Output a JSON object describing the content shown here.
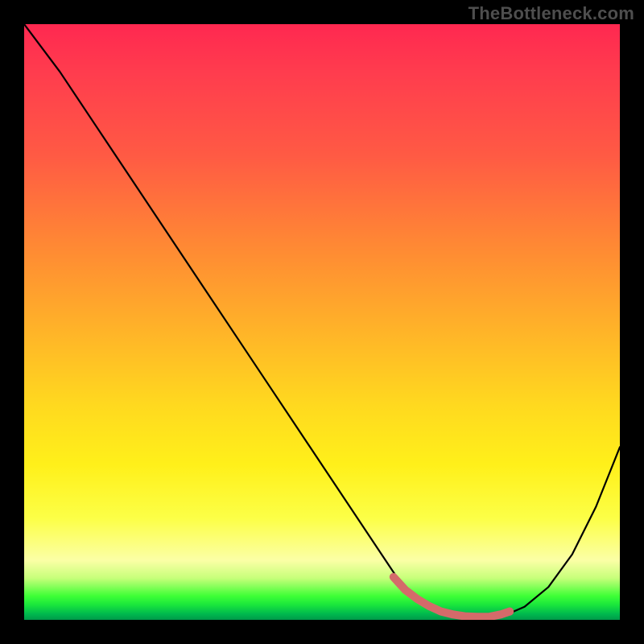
{
  "watermark": "TheBottleneck.com",
  "chart_data": {
    "type": "line",
    "title": "",
    "xlabel": "",
    "ylabel": "",
    "xlim": [
      0,
      100
    ],
    "ylim": [
      0,
      100
    ],
    "grid": false,
    "legend": false,
    "background": "red-yellow-green vertical gradient",
    "series": [
      {
        "name": "bottleneck-curve",
        "color": "#000000",
        "x": [
          0,
          6,
          12,
          18,
          24,
          30,
          36,
          42,
          48,
          54,
          60,
          63,
          66,
          69,
          72,
          75,
          78,
          81,
          84,
          88,
          92,
          96,
          100
        ],
        "y": [
          100,
          92,
          83,
          74,
          65,
          56,
          47,
          38,
          29,
          20,
          11,
          6.5,
          3.5,
          1.8,
          0.9,
          0.5,
          0.5,
          0.9,
          2.2,
          5.5,
          11,
          19,
          29
        ]
      },
      {
        "name": "optimal-range-highlight",
        "color": "#d46a6a",
        "x": [
          62,
          64,
          66,
          68,
          70,
          72,
          74,
          76,
          78,
          80,
          81.5
        ],
        "y": [
          7.2,
          5.0,
          3.5,
          2.3,
          1.4,
          0.9,
          0.6,
          0.5,
          0.5,
          0.9,
          1.4
        ]
      }
    ],
    "annotations": [],
    "colors": {
      "gradient_top": "#ff2850",
      "gradient_mid": "#ffd91f",
      "gradient_bottom": "#009a4a",
      "curve": "#000000",
      "highlight": "#d46a6a",
      "frame": "#000000"
    }
  }
}
